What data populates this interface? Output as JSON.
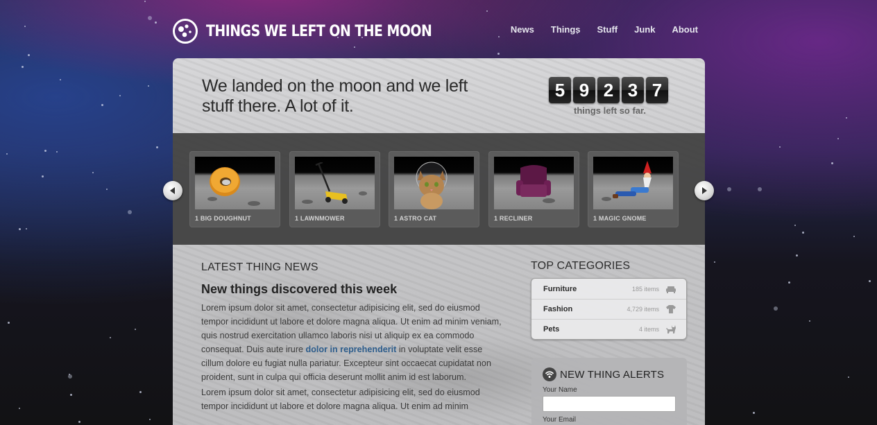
{
  "site": {
    "title": "THINGS WE LEFT ON THE MOON"
  },
  "nav": [
    {
      "label": "News"
    },
    {
      "label": "Things"
    },
    {
      "label": "Stuff"
    },
    {
      "label": "Junk"
    },
    {
      "label": "About"
    }
  ],
  "hero": {
    "title": "We landed on the moon and we left stuff there. A lot of it.",
    "counter_digits": [
      "5",
      "9",
      "2",
      "3",
      "7"
    ],
    "counter_label": "things left so far."
  },
  "carousel": {
    "items": [
      {
        "label": "1 BIG DOUGHNUT"
      },
      {
        "label": "1 LAWNMOWER"
      },
      {
        "label": "1 ASTRO CAT"
      },
      {
        "label": "1 RECLINER"
      },
      {
        "label": "1 MAGIC GNOME"
      }
    ]
  },
  "news": {
    "section_title": "LATEST THING NEWS",
    "heading": "New things discovered this week",
    "p1_before": "Lorem ipsum dolor sit amet, consectetur adipisicing elit, sed do eiusmod tempor incididunt ut labore et dolore magna aliqua. Ut enim ad minim veniam, quis nostrud exercitation ullamco laboris nisi ut aliquip ex ea commodo consequat. Duis aute irure ",
    "p1_link": "dolor in reprehenderit",
    "p1_after": " in voluptate velit esse cillum dolore eu fugiat nulla pariatur. Excepteur sint occaecat cupidatat non proident, sunt in culpa qui officia deserunt mollit anim id est laborum.",
    "p2": "Lorem ipsum dolor sit amet, consectetur adipisicing elit, sed do eiusmod tempor incididunt ut labore et dolore magna aliqua. Ut enim ad minim"
  },
  "categories": {
    "title": "TOP CATEGORIES",
    "items": [
      {
        "name": "Furniture",
        "count": "185 items",
        "icon": "sofa-icon"
      },
      {
        "name": "Fashion",
        "count": "4,729 items",
        "icon": "tshirt-icon"
      },
      {
        "name": "Pets",
        "count": "4 items",
        "icon": "cat-icon"
      }
    ]
  },
  "alerts": {
    "title": "NEW THING ALERTS",
    "name_label": "Your Name",
    "name_value": "",
    "email_label": "Your Email"
  },
  "colors": {
    "link": "#2d5d8c",
    "counter_bg": "#2c2c2c",
    "strip_bg": "#3e3e3e"
  }
}
